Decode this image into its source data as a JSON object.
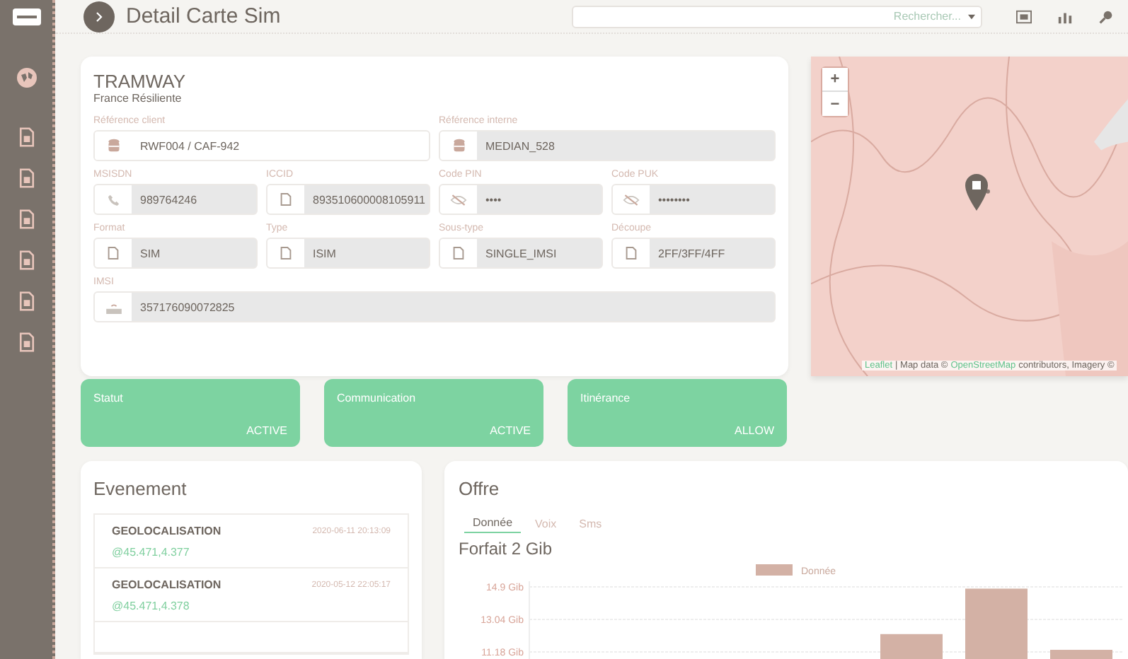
{
  "header": {
    "title": "Detail Carte Sim",
    "search_placeholder": "Rechercher..."
  },
  "sim": {
    "title": "TRAMWAY",
    "subtitle": "France Résiliente",
    "field_rows": [
      [
        {
          "label": "Référence client",
          "value": "RWF004 / CAF-942",
          "kind": "database",
          "disabled": false
        },
        {
          "label": "Référence interne",
          "value": "MEDIAN_528",
          "kind": "database",
          "disabled": true
        }
      ],
      [
        {
          "label": "MSISDN",
          "value": "989764246",
          "kind": "phone",
          "disabled": true
        },
        {
          "label": "ICCID",
          "value": "893510600008105911",
          "kind": "sim",
          "disabled": true
        },
        {
          "label": "Code PIN",
          "value": "••••",
          "kind": "hidden",
          "disabled": true
        },
        {
          "label": "Code PUK",
          "value": "••••••••",
          "kind": "hidden",
          "disabled": true
        }
      ],
      [
        {
          "label": "Format",
          "value": "SIM",
          "kind": "sim",
          "disabled": true
        },
        {
          "label": "Type",
          "value": "ISIM",
          "kind": "sim",
          "disabled": true
        },
        {
          "label": "Sous-type",
          "value": "SINGLE_IMSI",
          "kind": "sim",
          "disabled": true
        },
        {
          "label": "Découpe",
          "value": "2FF/3FF/4FF",
          "kind": "sim",
          "disabled": true
        }
      ],
      [
        {
          "label": "IMSI",
          "value": "357176090072825",
          "kind": "router",
          "disabled": true
        }
      ]
    ]
  },
  "map": {
    "zoom_in": "+",
    "zoom_out": "−",
    "attribution_link": "Leaflet",
    "attribution_text": "| Map data ©",
    "attribution_osm": "OpenStreetMap",
    "attribution_rest": "contributors, Imagery ©"
  },
  "statuses": [
    {
      "label": "Statut",
      "value": "ACTIVE"
    },
    {
      "label": "Communication",
      "value": "ACTIVE"
    },
    {
      "label": "Itinérance",
      "value": "ALLOW"
    }
  ],
  "events": {
    "title": "Evenement",
    "items": [
      {
        "type": "GEOLOCALISATION",
        "time": "2020-06-11 20:13:09",
        "position": "@45.471,4.377"
      },
      {
        "type": "GEOLOCALISATION",
        "time": "2020-05-12 22:05:17",
        "position": "@45.471,4.378"
      }
    ]
  },
  "offer": {
    "title": "Offre",
    "tabs": [
      {
        "label": "Donnée",
        "selected": true
      },
      {
        "label": "Voix",
        "selected": false
      },
      {
        "label": "Sms",
        "selected": false
      }
    ],
    "plan": "Forfait 2 Gib",
    "chart_data": {
      "type": "bar",
      "series": [
        {
          "name": "Donnée",
          "color": "#d3b1a5",
          "values": [
            null,
            null,
            null,
            null,
            12.2,
            14.8,
            11.3
          ]
        }
      ],
      "ylim": [
        11.18,
        14.9
      ],
      "yticks": [
        {
          "value": 14.9,
          "label": "14.9 Gib"
        },
        {
          "value": 13.04,
          "label": "13.04 Gib"
        },
        {
          "value": 11.18,
          "label": "11.18 Gib"
        }
      ]
    }
  }
}
